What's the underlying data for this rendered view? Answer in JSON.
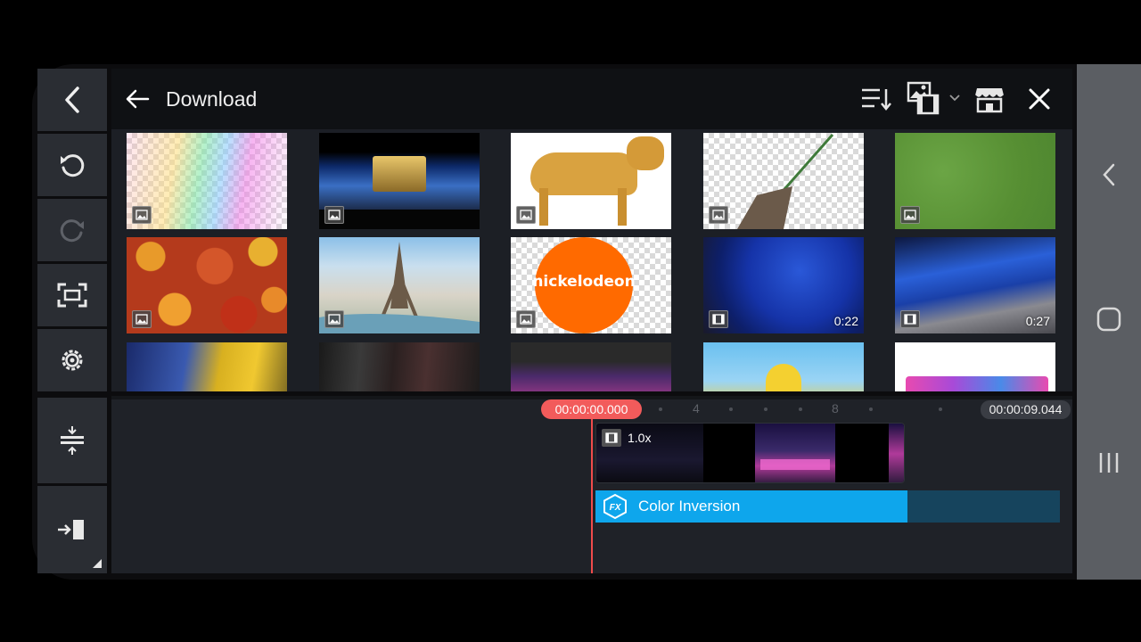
{
  "browser": {
    "title": "Download"
  },
  "thumbnails": [
    {
      "kind": "image",
      "duration": ""
    },
    {
      "kind": "image",
      "duration": ""
    },
    {
      "kind": "image",
      "duration": ""
    },
    {
      "kind": "image",
      "duration": ""
    },
    {
      "kind": "image",
      "duration": ""
    },
    {
      "kind": "image",
      "duration": ""
    },
    {
      "kind": "image",
      "duration": ""
    },
    {
      "kind": "image",
      "duration": "",
      "logo_text": "nickelodeon"
    },
    {
      "kind": "video",
      "duration": "0:22"
    },
    {
      "kind": "video",
      "duration": "0:27"
    },
    {
      "kind": "video",
      "duration": ""
    },
    {
      "kind": "video",
      "duration": ""
    },
    {
      "kind": "video",
      "duration": ""
    },
    {
      "kind": "video",
      "duration": ""
    },
    {
      "kind": "video",
      "duration": ""
    }
  ],
  "timeline": {
    "current_time": "00:00:00.000",
    "total_time": "00:00:09.044",
    "ruler_marks": [
      "4",
      "8"
    ],
    "clip_speed": "1.0x",
    "effect_label": "Color Inversion"
  },
  "colors": {
    "playhead": "#f25b5b",
    "effect": "#0ea6ec",
    "panel": "#1f2228"
  }
}
